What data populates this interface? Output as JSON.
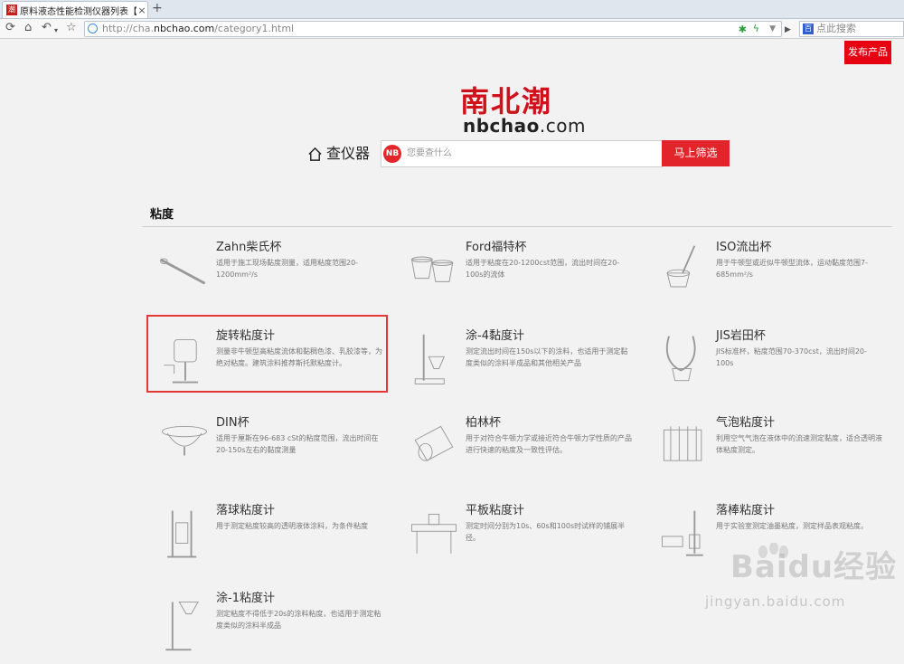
{
  "browser": {
    "tab_title": "原料液态性能检测仪器列表【查...",
    "tab_favicon": "潮",
    "url_prefix": "http://cha.",
    "url_domain": "nbchao.com",
    "url_path": "/category1.html",
    "search_placeholder": "点此搜索"
  },
  "header": {
    "publish_label": "发布产品",
    "logo_cn": "南北潮",
    "logo_en": "nbchao",
    "logo_tld": ".com",
    "search_label": "查仪器",
    "nb_badge": "NB",
    "search_placeholder": "您要查什么",
    "filter_label": "马上筛选"
  },
  "section": {
    "title": "粘度"
  },
  "items": [
    {
      "name": "Zahn柴氏杯",
      "desc": "适用于施工现场黏度测量，适用粘度范围20-1200mm²/s"
    },
    {
      "name": "Ford福特杯",
      "desc": "适用于粘度在20-1200cst范围，流出时间在20-100s的流体"
    },
    {
      "name": "ISO流出杯",
      "desc": "用于牛顿型或近似牛顿型流体，运动黏度范围7-685mm²/s"
    },
    {
      "name": "旋转粘度计",
      "desc": "测量非牛顿型高粘度流体和黏稠色漆、乳胶漆等，为绝对粘度。建筑涂料推荐斯托默粘度计。"
    },
    {
      "name": "涂-4黏度计",
      "desc": "测定流出时间在150s以下的涂料，也适用于测定黏度类似的涂料半成品和其他相关产品"
    },
    {
      "name": "JIS岩田杯",
      "desc": "JIS标准杯，粘度范围70-370cst，流出时间20-100s"
    },
    {
      "name": "DIN杯",
      "desc": "适用于厘斯在96-683 cSt的粘度范围，流出时间在20-150s左右的黏度测量"
    },
    {
      "name": "柏林杯",
      "desc": "用于对符合牛顿力学或接近符合牛顿力学性质的产品进行快速的粘度及一致性评估。"
    },
    {
      "name": "气泡粘度计",
      "desc": "利用空气气泡在液体中的流速测定黏度，适合透明液体粘度测定。"
    },
    {
      "name": "落球粘度计",
      "desc": "用于测定粘度较高的透明液体涂料，为条件粘度"
    },
    {
      "name": "平板粘度计",
      "desc": "测定时间分别为10s、60s和100s时试样的铺展半径。"
    },
    {
      "name": "落棒粘度计",
      "desc": "用于实验室测定油墨粘度，测定样品表观粘度。"
    },
    {
      "name": "涂-1粘度计",
      "desc": "测定粘度不得低于20s的涂料粘度，也适用于测定粘度类似的涂料半成品"
    }
  ],
  "watermark": {
    "brand": "Baidu经验",
    "url": "jingyan.baidu.com"
  },
  "colors": {
    "brand_red": "#e2252b",
    "publish_red": "#e60012",
    "highlight": "#e53935"
  }
}
